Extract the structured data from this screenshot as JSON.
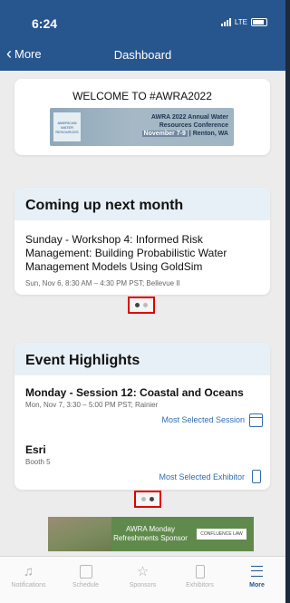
{
  "status": {
    "time": "6:24",
    "network": "LTE"
  },
  "nav": {
    "back_label": "More",
    "title": "Dashboard"
  },
  "welcome": {
    "title": "WELCOME TO #AWRA2022",
    "banner_line1": "AWRA 2022 Annual Water",
    "banner_line2": "Resources Conference",
    "banner_dates": "November 7-9",
    "banner_sep": "|",
    "banner_location": "Renton, WA",
    "banner_logo_text": "AMERICAN WATER RESOURCES"
  },
  "coming_up": {
    "heading": "Coming up next month",
    "event_title": "Sunday - Workshop 4: Informed Risk Management: Building Probabilistic Water Management Models Using GoldSim",
    "event_time": "Sun, Nov 6, 8:30 AM – 4:30 PM PST; Bellevue II"
  },
  "highlights": {
    "heading": "Event Highlights",
    "session_title": "Monday - Session 12: Coastal and Oceans",
    "session_time": "Mon, Nov 7, 3:30 – 5:00 PM PST; Rainier",
    "session_tag": "Most Selected Session",
    "exhibitor_name": "Esri",
    "exhibitor_booth": "Booth 5",
    "exhibitor_tag": "Most Selected Exhibitor"
  },
  "sponsor": {
    "line1": "AWRA Monday",
    "line2": "Refreshments Sponsor",
    "logo_text": "CONFLUENCE LAW"
  },
  "tabs": [
    {
      "label": "Notifications",
      "icon": "bell-icon"
    },
    {
      "label": "Schedule",
      "icon": "calendar-icon"
    },
    {
      "label": "Sponsors",
      "icon": "star-icon"
    },
    {
      "label": "Exhibitors",
      "icon": "badge-icon"
    },
    {
      "label": "More",
      "icon": "menu-icon"
    }
  ],
  "colors": {
    "nav_blue": "#27558e",
    "link_blue": "#2f6db3",
    "highlight_red": "#e00000"
  }
}
